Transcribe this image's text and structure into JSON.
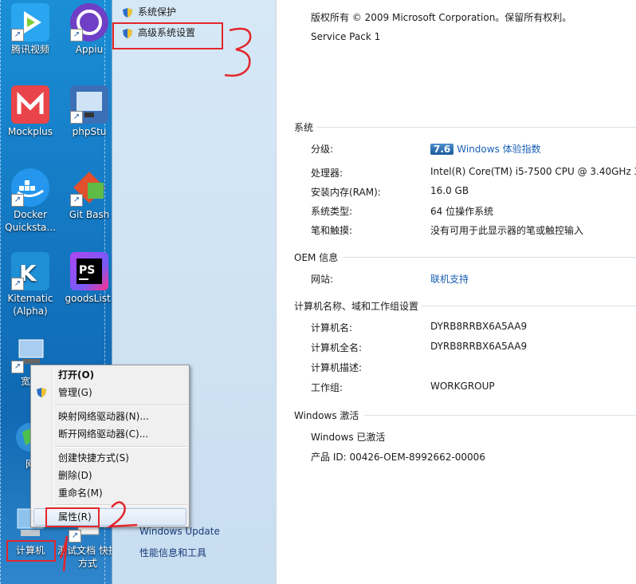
{
  "desktop": {
    "icons": [
      {
        "label": "腾讯视频",
        "icon": "tencent-video-icon",
        "color": "#2aa6f0"
      },
      {
        "label": "Appiu",
        "icon": "appium-icon",
        "color": "#6f3fc6"
      },
      {
        "label": "Mockplus",
        "icon": "mockplus-icon",
        "color": "#e8444a"
      },
      {
        "label": "phpStu",
        "icon": "phpstudy-icon",
        "color": "#3b6fb6"
      },
      {
        "label": "Docker Quicksta...",
        "icon": "docker-icon",
        "color": "#2496ed"
      },
      {
        "label": "Git Bash",
        "icon": "git-bash-icon",
        "color": "#e14f2d"
      },
      {
        "label": "Kitematic (Alpha)",
        "icon": "kitematic-icon",
        "color": "#1f8fd6"
      },
      {
        "label": "goodsList.",
        "icon": "phpstorm-icon",
        "color": "#222222"
      },
      {
        "label": "宽带",
        "icon": "broadband-icon",
        "color": "#4f86c6"
      },
      {
        "label": "网",
        "icon": "network-icon",
        "color": "#2f8f3f"
      },
      {
        "label": "计算机",
        "icon": "computer-icon",
        "color": "#5aa0d8"
      },
      {
        "label": "测试文档 快捷方式",
        "icon": "document-icon",
        "color": "#eeeeee"
      }
    ]
  },
  "nav": {
    "items": [
      "系统保护",
      "高级系统设置"
    ],
    "see_also": [
      "Windows Update",
      "性能信息和工具"
    ]
  },
  "main": {
    "copyright": "版权所有 © 2009 Microsoft Corporation。保留所有权利。",
    "service_pack": "Service Pack 1",
    "system": {
      "heading": "系统",
      "rating_label": "分级:",
      "rating_score": "7.6",
      "rating_link": "Windows 体验指数",
      "processor_label": "处理器:",
      "processor_value": "Intel(R) Core(TM) i5-7500 CPU @ 3.40GHz   3",
      "ram_label": "安装内存(RAM):",
      "ram_value": "16.0 GB",
      "type_label": "系统类型:",
      "type_value": "64 位操作系统",
      "pen_label": "笔和触摸:",
      "pen_value": "没有可用于此显示器的笔或触控输入"
    },
    "oem": {
      "heading": "OEM 信息",
      "website_label": "网站:",
      "website_value": "联机支持"
    },
    "computer_name": {
      "heading": "计算机名称、域和工作组设置",
      "name_label": "计算机名:",
      "name_value": "DYRB8RRBX6A5AA9",
      "fullname_label": "计算机全名:",
      "fullname_value": "DYRB8RRBX6A5AA9",
      "desc_label": "计算机描述:",
      "workgroup_label": "工作组:",
      "workgroup_value": "WORKGROUP"
    },
    "activation": {
      "heading": "Windows 激活",
      "status": "Windows 已激活",
      "product_id": "产品 ID: 00426-OEM-8992662-00006"
    }
  },
  "context_menu": {
    "open": "打开(O)",
    "manage": "管理(G)",
    "map_drive": "映射网络驱动器(N)...",
    "disconnect_drive": "断开网络驱动器(C)...",
    "create_shortcut": "创建快捷方式(S)",
    "delete": "删除(D)",
    "rename": "重命名(M)",
    "properties": "属性(R)"
  },
  "annotations": {
    "step1": "1",
    "step2": "2",
    "step3": "3",
    "color": "#e3262b"
  }
}
